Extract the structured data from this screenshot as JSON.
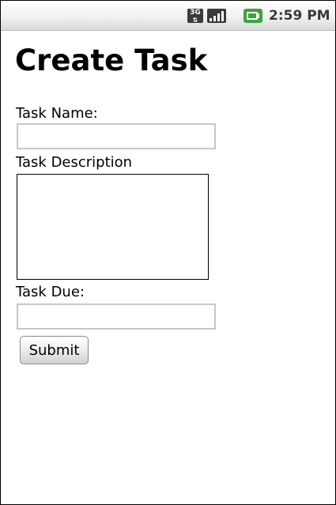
{
  "status_bar": {
    "network_icon": "3g-data-icon",
    "network_label": "3G",
    "signal_icon": "signal-bars-icon",
    "battery_icon": "battery-charging-icon",
    "time": "2:59 PM"
  },
  "form": {
    "title": "Create Task",
    "task_name_label": "Task Name:",
    "task_name_value": "",
    "task_description_label": "Task Description",
    "task_description_value": "",
    "task_due_label": "Task Due:",
    "task_due_value": "",
    "submit_label": "Submit"
  },
  "colors": {
    "text": "#000000",
    "input_border": "#c7c7c7",
    "status_bar_text": "#3a3a3a",
    "signal_green": "#3fa33f"
  }
}
